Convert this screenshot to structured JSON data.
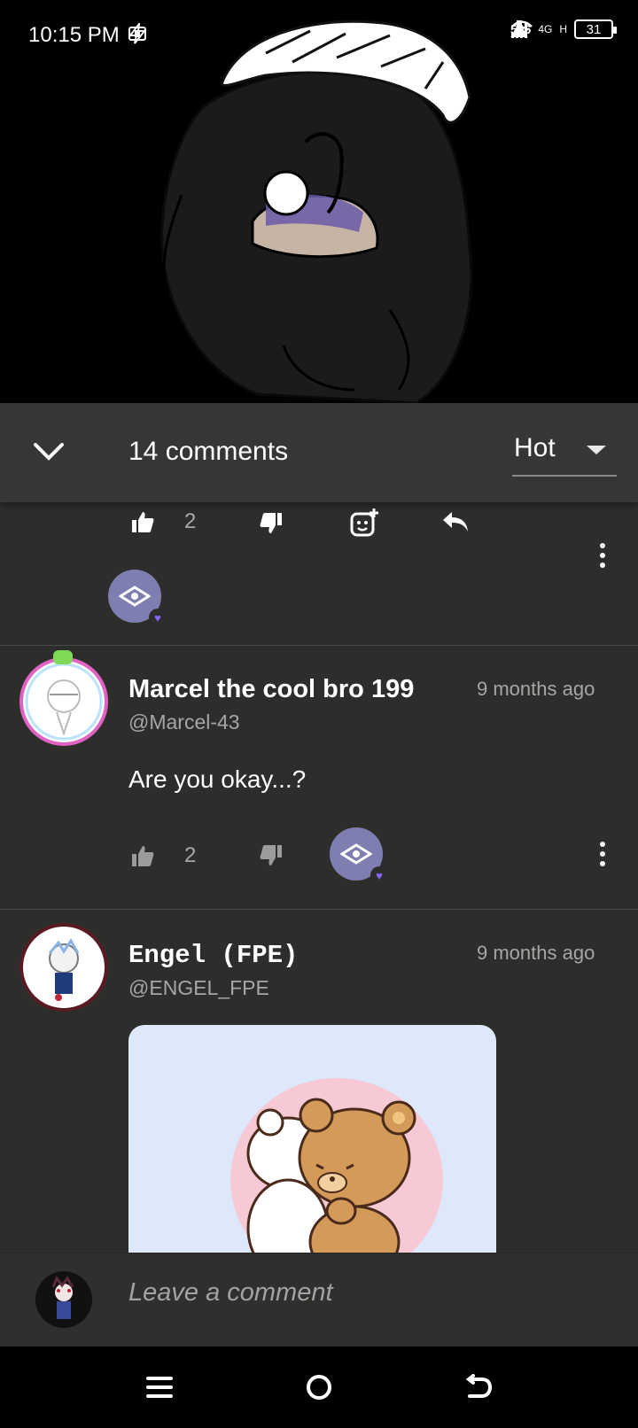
{
  "status_bar": {
    "time": "10:15 PM",
    "net_speed": "546",
    "network_4g": "4G",
    "network_h": "H",
    "battery": "31"
  },
  "comments_header": {
    "count_label": "14 comments",
    "sort_value": "Hot"
  },
  "first_comment_tail": {
    "like_count": "2"
  },
  "comments": [
    {
      "author": "Marcel the cool bro 199",
      "handle": "@Marcel-43",
      "time": "9 months ago",
      "text": "Are you okay...?",
      "like_count": "2"
    },
    {
      "author": "Engel (FPE)",
      "handle": "@ENGEL_FPE",
      "time": "9 months ago"
    }
  ],
  "compose": {
    "placeholder": "Leave a comment"
  },
  "colors": {
    "background": "#2d2d2b",
    "header": "#363634",
    "reaction_badge": "#7f7eb1",
    "heart": "#8b63ff",
    "muted_text": "#a6a6a4"
  },
  "icons": [
    "chevron-down-icon",
    "thumbs-up-icon",
    "thumbs-down-icon",
    "add-sticker-icon",
    "reply-icon",
    "more-vertical-icon",
    "eye-reaction-icon",
    "menu-icon",
    "home-circle-icon",
    "back-icon"
  ]
}
